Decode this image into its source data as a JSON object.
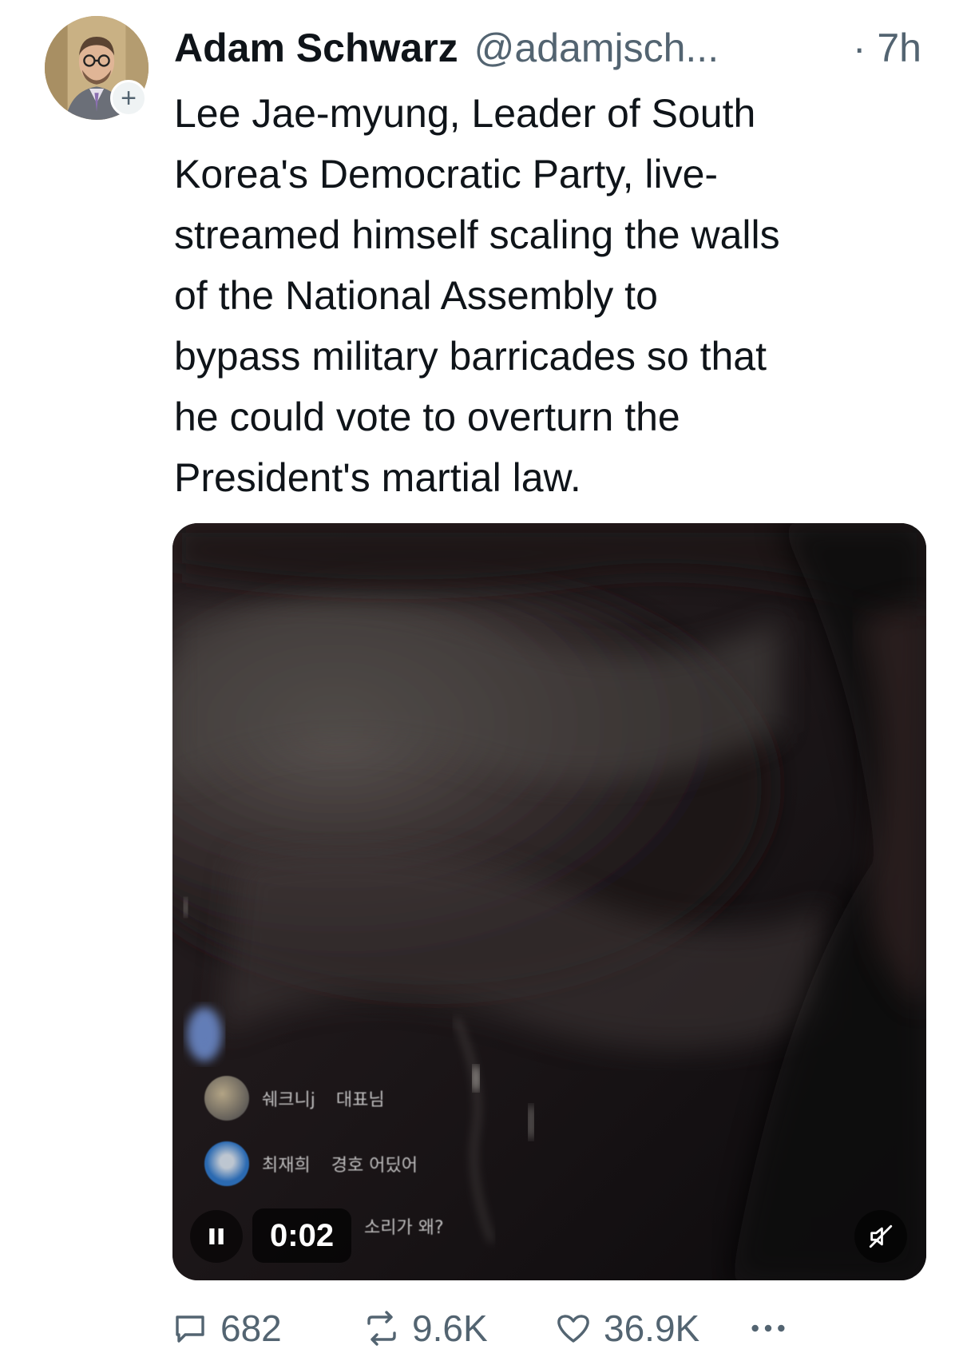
{
  "tweet": {
    "author": {
      "display_name": "Adam Schwarz",
      "handle": "@adamjsch...",
      "time": "· 7h",
      "avatar_icon": "profile-photo",
      "follow_badge": "+"
    },
    "text": "Lee Jae-myung, Leader of South\nKorea's Democratic Party, live-\nstreamed himself scaling the walls\nof the National Assembly to\nbypass military barricades so that\nhe could vote to overturn the\nPresident's martial law.",
    "video": {
      "timestamp": "0:02",
      "state_icon": "pause-icon",
      "audio_icon": "mute-icon",
      "chat_overlay": [
        {
          "user": "쉐크니j",
          "message": "대표님"
        },
        {
          "user": "최재희",
          "message": "경호 어딨어"
        },
        {
          "user": "",
          "message": "소리가 왜?"
        }
      ]
    },
    "actions": {
      "replies": "682",
      "retweets": "9.6K",
      "likes": "36.9K",
      "more_icon": "more-icon"
    }
  },
  "colors": {
    "text_primary": "#0f1419",
    "text_secondary": "#536471",
    "background": "#ffffff"
  }
}
